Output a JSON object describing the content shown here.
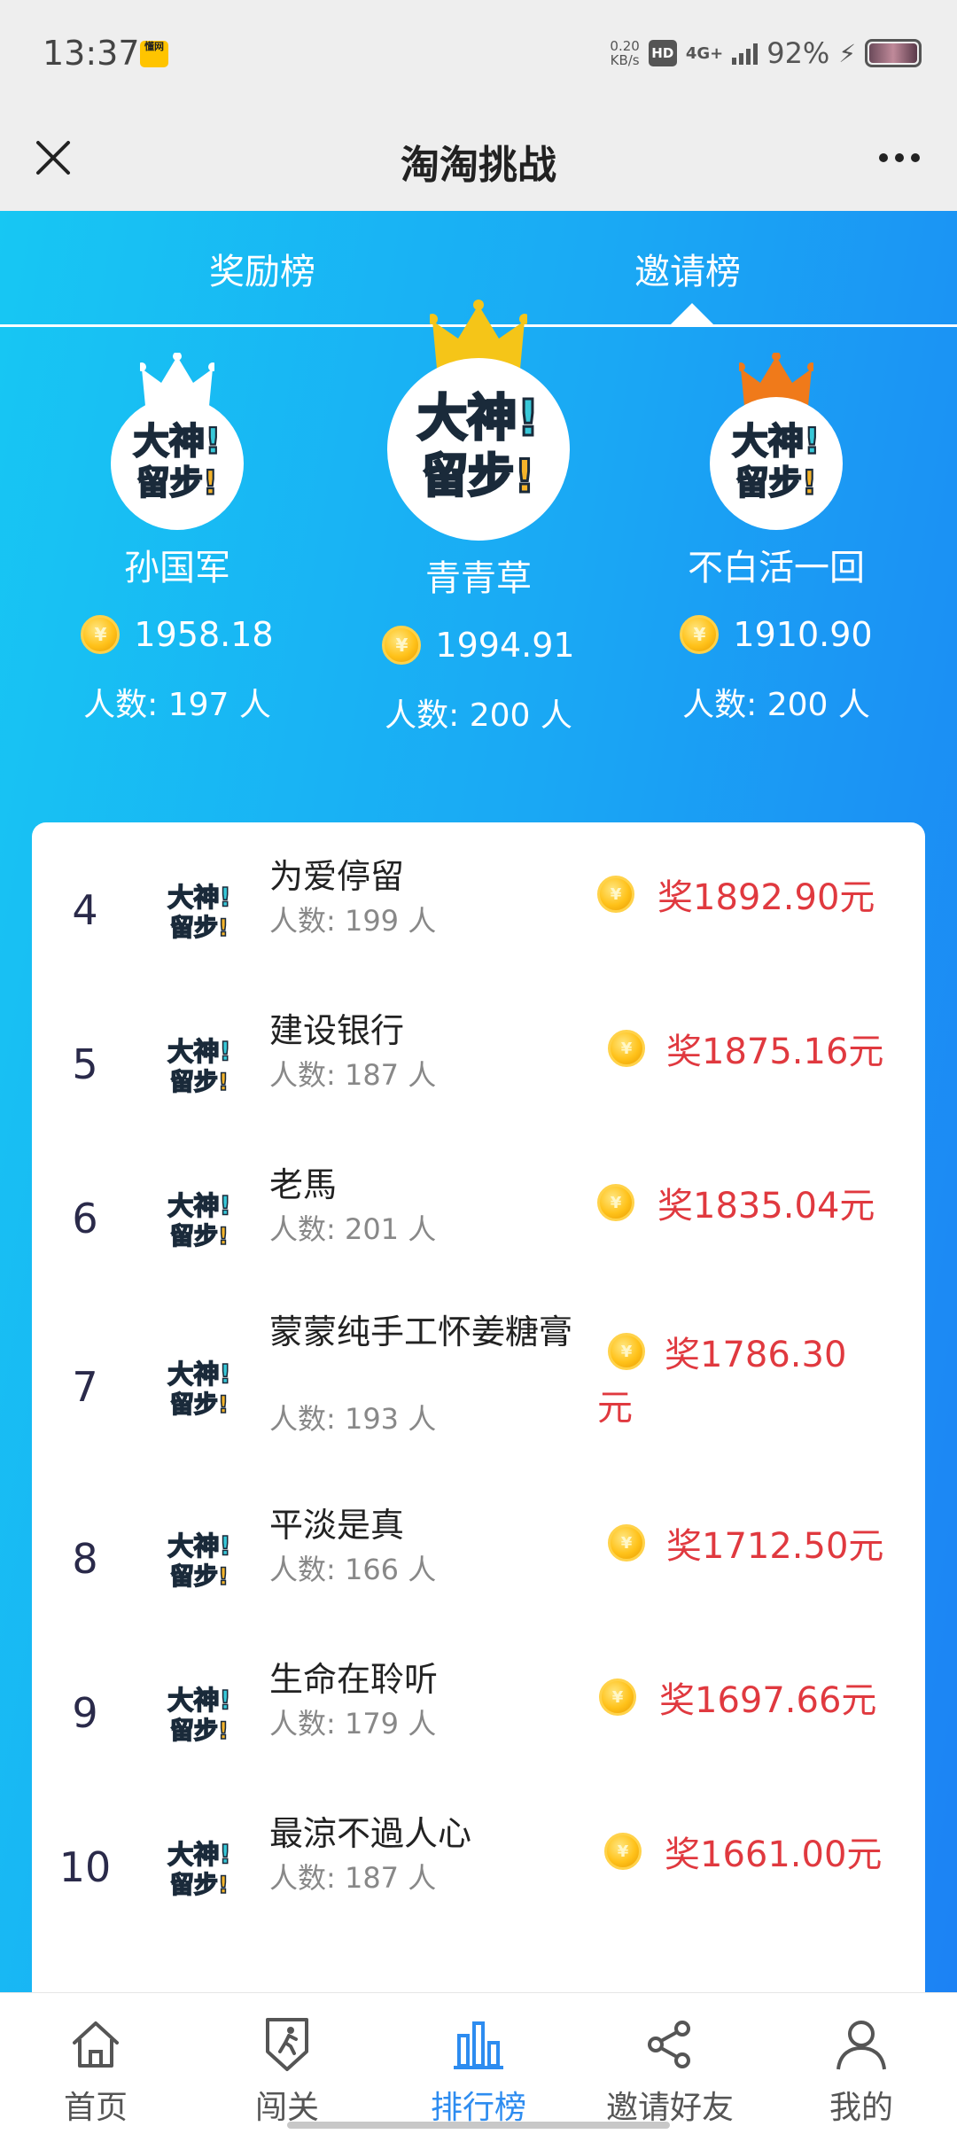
{
  "status_bar": {
    "time": "13:37",
    "app_badge": "懂网",
    "net_speed_value": "0.20",
    "net_speed_unit": "KB/s",
    "hd": "HD",
    "network": "4G+",
    "battery": "92%"
  },
  "header": {
    "title": "淘淘挑战",
    "close_icon": "close-icon",
    "more_icon": "more-icon"
  },
  "tabs": [
    {
      "label": "奖励榜",
      "active": false
    },
    {
      "label": "邀请榜",
      "active": true
    }
  ],
  "podium": {
    "first": {
      "name": "青青草",
      "amount": "1994.91",
      "count": "人数: 200 人",
      "crown_color": "#f5c518"
    },
    "second": {
      "name": "孙国军",
      "amount": "1958.18",
      "count": "人数: 197 人",
      "crown_color": "#ffffff"
    },
    "third": {
      "name": "不白活一回",
      "amount": "1910.90",
      "count": "人数: 200 人",
      "crown_color": "#f07a1a"
    }
  },
  "list": [
    {
      "rank": "4",
      "name": "为爱停留",
      "count": "人数: 199 人",
      "prize": "奖1892.90元"
    },
    {
      "rank": "5",
      "name": "建设银行",
      "count": "人数: 187 人",
      "prize": "奖1875.16元"
    },
    {
      "rank": "6",
      "name": "老馬",
      "count": "人数: 201 人",
      "prize": "奖1835.04元"
    },
    {
      "rank": "7",
      "name": "蒙蒙纯手工怀姜糖膏",
      "count": "人数: 193 人",
      "prize_line1": "奖1786.30",
      "prize_line2": "元"
    },
    {
      "rank": "8",
      "name": "平淡是真",
      "count": "人数: 166 人",
      "prize": "奖1712.50元"
    },
    {
      "rank": "9",
      "name": "生命在聆听",
      "count": "人数: 179 人",
      "prize": "奖1697.66元"
    },
    {
      "rank": "10",
      "name": "最涼不過人心",
      "count": "人数: 187 人",
      "prize": "奖1661.00元"
    }
  ],
  "avatar_text": {
    "line1": "大神!",
    "line2": "留步!"
  },
  "bottom_nav": [
    {
      "label": "首页",
      "icon": "home-icon",
      "active": false
    },
    {
      "label": "闯关",
      "icon": "runner-shield-icon",
      "active": false
    },
    {
      "label": "排行榜",
      "icon": "bar-chart-icon",
      "active": true
    },
    {
      "label": "邀请好友",
      "icon": "share-icon",
      "active": false
    },
    {
      "label": "我的",
      "icon": "user-icon",
      "active": false
    }
  ],
  "colors": {
    "accent_blue": "#2d8cf0",
    "prize_red": "#e0393f",
    "gradient_start": "#17c7f3",
    "gradient_end": "#1c82f4"
  }
}
